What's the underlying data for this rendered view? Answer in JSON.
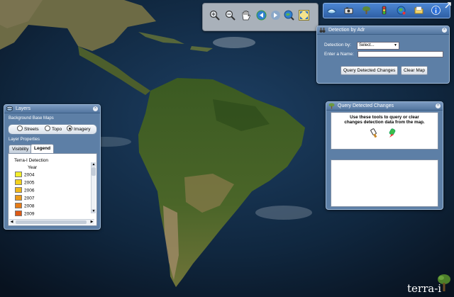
{
  "app": {
    "brand": "terra-i"
  },
  "colors": {
    "panel": "#5d7fa6",
    "header": "#53769f",
    "toolbar": "#2e5fa5"
  },
  "navigation_toolbar": {
    "tools": [
      {
        "name": "zoom-in-icon"
      },
      {
        "name": "zoom-out-icon"
      },
      {
        "name": "pan-hand-icon"
      },
      {
        "name": "previous-extent-icon"
      },
      {
        "name": "next-extent-icon"
      },
      {
        "name": "full-extent-icon"
      },
      {
        "name": "expand-view-icon"
      }
    ]
  },
  "top_toolbar": {
    "tools": [
      {
        "name": "basemap-icon"
      },
      {
        "name": "camera-icon"
      },
      {
        "name": "tree-icon"
      },
      {
        "name": "traffic-light-icon"
      },
      {
        "name": "globe-icon"
      },
      {
        "name": "folder-icon"
      },
      {
        "name": "info-icon"
      }
    ]
  },
  "layers_panel": {
    "title": "Layers",
    "close": "×",
    "background_label": "Background Base Maps",
    "basemaps": [
      {
        "label": "Streets",
        "selected": false
      },
      {
        "label": "Topo",
        "selected": false
      },
      {
        "label": "Imagery",
        "selected": true
      }
    ],
    "properties_label": "Layer Properties",
    "tabs": [
      {
        "label": "Visibility",
        "active": false
      },
      {
        "label": "Legend",
        "active": true
      }
    ],
    "legend": {
      "title": "Terra-I Detection",
      "subtitle": "Year",
      "items": [
        {
          "label": "2004",
          "color": "#f3ee2a"
        },
        {
          "label": "2005",
          "color": "#f4d21c"
        },
        {
          "label": "2006",
          "color": "#f0b81a"
        },
        {
          "label": "2007",
          "color": "#ec9a18"
        },
        {
          "label": "2008",
          "color": "#e67b16"
        },
        {
          "label": "2009",
          "color": "#de5a14"
        }
      ]
    }
  },
  "detection_panel": {
    "title": "Detection by Adr",
    "close": "×",
    "detection_by_label": "Detection by:",
    "detection_by_value": "Select...",
    "name_label": "Enter a Name:",
    "name_value": "",
    "query_button": "Query Detected Changes",
    "clear_button": "Clear Map"
  },
  "query_panel": {
    "title": "Query Detected Changes",
    "close": "×",
    "instructions_line1": "Use these tools to query or clear",
    "instructions_line2": "changes detection data from the map."
  }
}
